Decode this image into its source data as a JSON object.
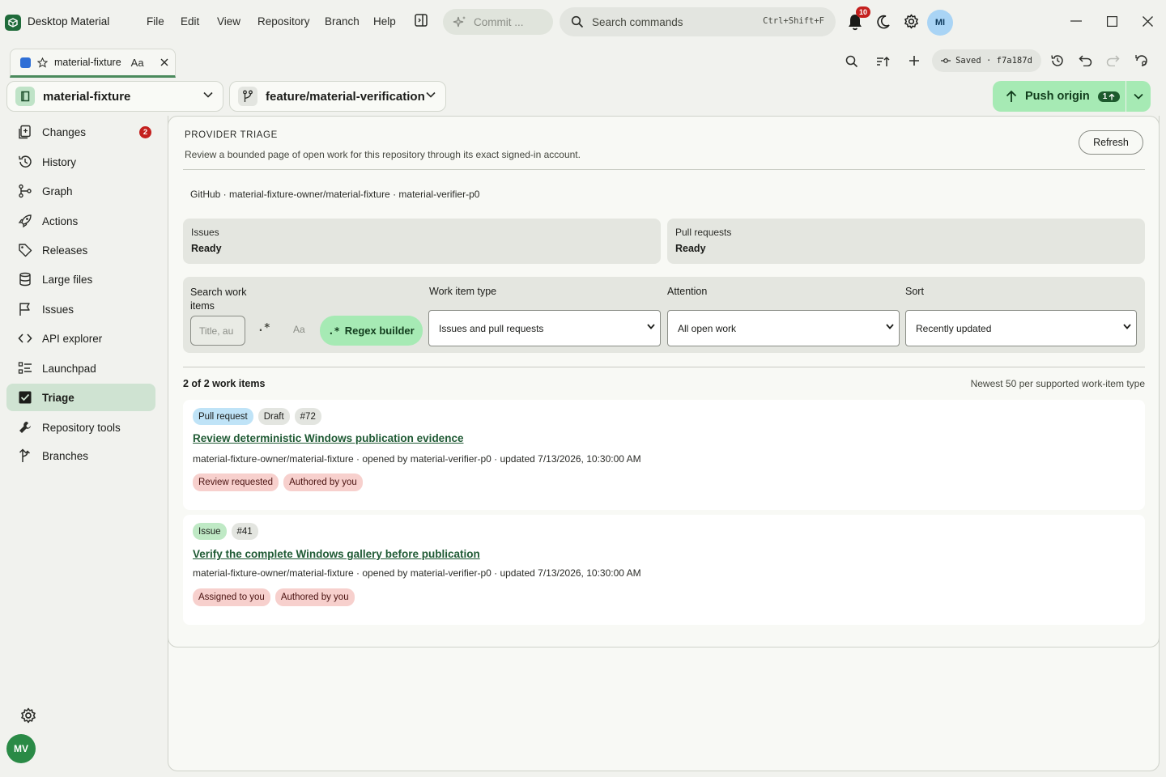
{
  "app": {
    "name": "Desktop Material"
  },
  "menu": [
    "File",
    "Edit",
    "View",
    "Repository",
    "Branch",
    "Help"
  ],
  "commit_pill": {
    "label": "Commit ..."
  },
  "search": {
    "placeholder": "Search commands",
    "shortcut": "Ctrl+Shift+F"
  },
  "notifications": {
    "count": "10"
  },
  "user": {
    "initials": "MI"
  },
  "tab": {
    "label": "material-fixture",
    "case_label": "Aa"
  },
  "saved": {
    "label": "Saved · f7a187d"
  },
  "repo": {
    "name": "material-fixture"
  },
  "branch": {
    "name": "feature/material-verification"
  },
  "push": {
    "label": "Push origin",
    "count": "1"
  },
  "sidebar": {
    "items": [
      {
        "label": "Changes",
        "icon": "changes-icon",
        "badge": "2"
      },
      {
        "label": "History",
        "icon": "history-icon"
      },
      {
        "label": "Graph",
        "icon": "graph-icon"
      },
      {
        "label": "Actions",
        "icon": "rocket-icon"
      },
      {
        "label": "Releases",
        "icon": "tag-icon"
      },
      {
        "label": "Large files",
        "icon": "database-icon"
      },
      {
        "label": "Issues",
        "icon": "flag-icon"
      },
      {
        "label": "API explorer",
        "icon": "code-icon"
      },
      {
        "label": "Launchpad",
        "icon": "checklist-icon"
      },
      {
        "label": "Triage",
        "icon": "triage-icon",
        "active": true
      },
      {
        "label": "Repository tools",
        "icon": "wrench-icon"
      },
      {
        "label": "Branches",
        "icon": "branches-icon"
      }
    ],
    "footer_initials": "MV"
  },
  "triage": {
    "eyebrow": "PROVIDER TRIAGE",
    "subtitle": "Review a bounded page of open work for this repository through its exact signed-in account.",
    "refresh_label": "Refresh",
    "provider_line": "GitHub · material-fixture-owner/material-fixture · material-verifier-p0",
    "status": [
      {
        "label": "Issues",
        "value": "Ready"
      },
      {
        "label": "Pull requests",
        "value": "Ready"
      }
    ],
    "filters": {
      "search_label": "Search work items",
      "search_placeholder": "Title, au",
      "regex_toggle": ".*",
      "case_toggle": "Aa",
      "regex_builder_label": "Regex builder",
      "regex_builder_glyph": ".*",
      "type_label": "Work item type",
      "type_value": "Issues and pull requests",
      "attention_label": "Attention",
      "attention_value": "All open work",
      "sort_label": "Sort",
      "sort_value": "Recently updated"
    },
    "count_text": "2 of 2 work items",
    "count_note": "Newest 50 per supported work-item type",
    "items": [
      {
        "chips": [
          "Pull request",
          "Draft",
          "#72"
        ],
        "title": "Review deterministic Windows publication evidence",
        "meta": "material-fixture-owner/material-fixture · opened by material-verifier-p0 · updated 7/13/2026, 10:30:00 AM",
        "tags": [
          "Review requested",
          "Authored by you"
        ]
      },
      {
        "chips": [
          "Issue",
          "#41"
        ],
        "title": "Verify the complete Windows gallery before publication",
        "meta": "material-fixture-owner/material-fixture · opened by material-verifier-p0 · updated 7/13/2026, 10:30:00 AM",
        "tags": [
          "Assigned to you",
          "Authored by you"
        ]
      }
    ]
  }
}
